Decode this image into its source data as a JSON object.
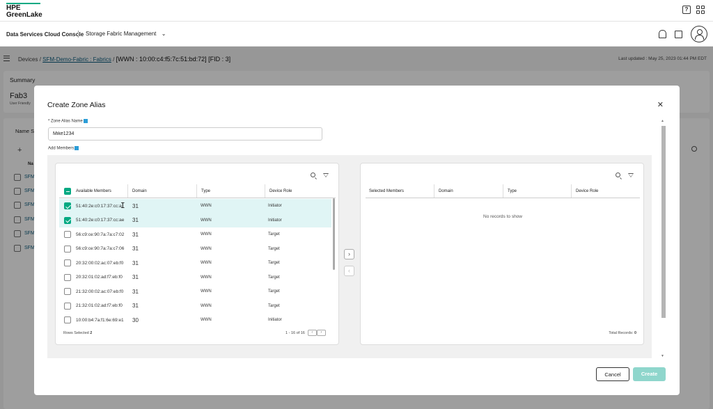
{
  "brand": {
    "line1": "HPE",
    "line2": "GreenLake",
    "accent": "#01a982"
  },
  "header": {
    "console_title": "Data Services Cloud Console",
    "app_selector": "Storage Fabric Management"
  },
  "breadcrumb": {
    "devices": "Devices",
    "fabric": "SFM-Demo-Fabric : Fabrics",
    "current": "[WWN : 10:00:c4:f5:7c:51:bd:72] [FID : 3]",
    "sep": "/"
  },
  "last_updated": "Last updated : May 25, 2023 01:44 PM EDT",
  "summary": {
    "title": "Summary",
    "fabric_name": "Fab3",
    "fabric_sub": "User Friendly"
  },
  "background_list": {
    "name_selector": "Name Se",
    "col": "Na",
    "rows": [
      "SFM",
      "SFM",
      "SFM",
      "SFM",
      "SFM",
      "SFM"
    ]
  },
  "modal": {
    "title": "Create Zone Alias",
    "zone_alias_label": "* Zone Alias Name",
    "zone_alias_value": "Mike1234",
    "add_members_label": "Add Members",
    "cancel_label": "Cancel",
    "create_label": "Create",
    "move_right": "›",
    "move_left": "‹"
  },
  "available": {
    "columns": [
      "Available Members",
      "Domain",
      "Type",
      "Device Role"
    ],
    "rows": [
      {
        "member": "51:40:2e:c0:17:37:cc:a",
        "domain": "31",
        "type": "WWN",
        "role": "Initiator",
        "checked": true
      },
      {
        "member": "51:40:2e:c0:17:37:cc:ae",
        "domain": "31",
        "type": "WWN",
        "role": "Initiator",
        "checked": true
      },
      {
        "member": "56:c9:ce:90:7a:7a:c7:02",
        "domain": "31",
        "type": "WWN",
        "role": "Target",
        "checked": false
      },
      {
        "member": "56:c9:ce:90:7a:7a:c7:06",
        "domain": "31",
        "type": "WWN",
        "role": "Target",
        "checked": false
      },
      {
        "member": "20:32:00:02:ac:07:eb:f0",
        "domain": "31",
        "type": "WWN",
        "role": "Target",
        "checked": false
      },
      {
        "member": "20:32:01:02:ad:f7:eb:f0",
        "domain": "31",
        "type": "WWN",
        "role": "Target",
        "checked": false
      },
      {
        "member": "21:32:00:02:ac:07:eb:f0",
        "domain": "31",
        "type": "WWN",
        "role": "Target",
        "checked": false
      },
      {
        "member": "21:32:01:02:ad:f7:eb:f0",
        "domain": "31",
        "type": "WWN",
        "role": "Target",
        "checked": false
      },
      {
        "member": "10:00:b4:7a:f1:6e:69:e1",
        "domain": "30",
        "type": "WWN",
        "role": "Initiator",
        "checked": false
      }
    ],
    "rows_selected_label": "Rows Selected",
    "rows_selected_count": "2",
    "pagination": "1 - 16 of 16"
  },
  "selected": {
    "columns": [
      "Selected Members",
      "Domain",
      "Type",
      "Device Role"
    ],
    "empty_text": "No records to show",
    "total_label": "Total Records:",
    "total_count": "0"
  }
}
